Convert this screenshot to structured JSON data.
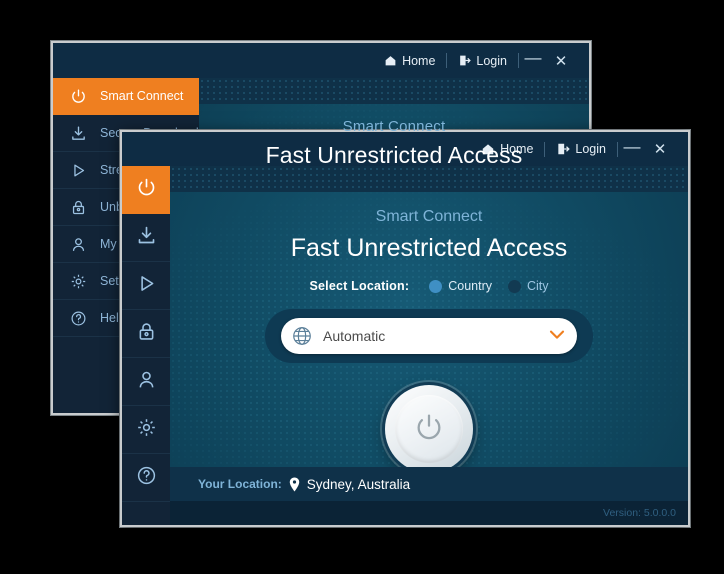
{
  "back_window": {
    "titlebar": {
      "home_label": "Home",
      "home_icon": "home-icon",
      "login_label": "Login",
      "login_icon": "login-arrow-icon",
      "minimize_label": "—",
      "close_label": "✕"
    },
    "sidebar": {
      "items": [
        {
          "label": "Smart Connect",
          "icon": "power-icon",
          "active": true
        },
        {
          "label": "Secure Download",
          "icon": "download-icon",
          "active": false
        },
        {
          "label": "Streaming",
          "icon": "play-icon",
          "active": false
        },
        {
          "label": "Unblock",
          "icon": "lock-icon",
          "active": false
        },
        {
          "label": "My Account",
          "icon": "user-icon",
          "active": false
        },
        {
          "label": "Settings",
          "icon": "gear-icon",
          "active": false
        },
        {
          "label": "Help",
          "icon": "help-icon",
          "active": false
        }
      ]
    },
    "content": {
      "subtitle": "Smart Connect",
      "title": "Fast Unrestricted Access"
    }
  },
  "front_window": {
    "titlebar": {
      "home_label": "Home",
      "home_icon": "home-icon",
      "login_label": "Login",
      "login_icon": "login-arrow-icon",
      "minimize_label": "—",
      "close_label": "✕"
    },
    "sidebar": {
      "items": [
        {
          "icon": "power-icon",
          "name": "smart-connect",
          "active": true
        },
        {
          "icon": "download-icon",
          "name": "secure-download",
          "active": false
        },
        {
          "icon": "play-icon",
          "name": "streaming",
          "active": false
        },
        {
          "icon": "lock-icon",
          "name": "unblock",
          "active": false
        },
        {
          "icon": "user-icon",
          "name": "my-account",
          "active": false
        },
        {
          "icon": "gear-icon",
          "name": "settings",
          "active": false
        },
        {
          "icon": "help-icon",
          "name": "help",
          "active": false
        }
      ]
    },
    "content": {
      "subtitle": "Smart Connect",
      "title": "Fast Unrestricted Access",
      "select_location_label": "Select Location:",
      "radio_country_label": "Country",
      "radio_city_label": "City",
      "radio_selected": "Country",
      "location_select": {
        "icon": "globe-icon",
        "value": "Automatic",
        "chevron": "⌄",
        "chevron_icon": "chevron-down-icon"
      },
      "power_button_icon": "power-icon",
      "your_location_label": "Your Location:",
      "your_location_icon": "map-pin-icon",
      "your_location_value": "Sydney, Australia",
      "version_text": "Version: 5.0.0.0"
    }
  },
  "colors": {
    "accent_orange": "#ef7f20",
    "sidebar_dark": "#122437",
    "titlebar": "#0e2c44",
    "content_teal": "#104a62",
    "text_light_blue": "#7fb4d8",
    "white": "#ffffff",
    "version_text": "#2f5f80"
  }
}
